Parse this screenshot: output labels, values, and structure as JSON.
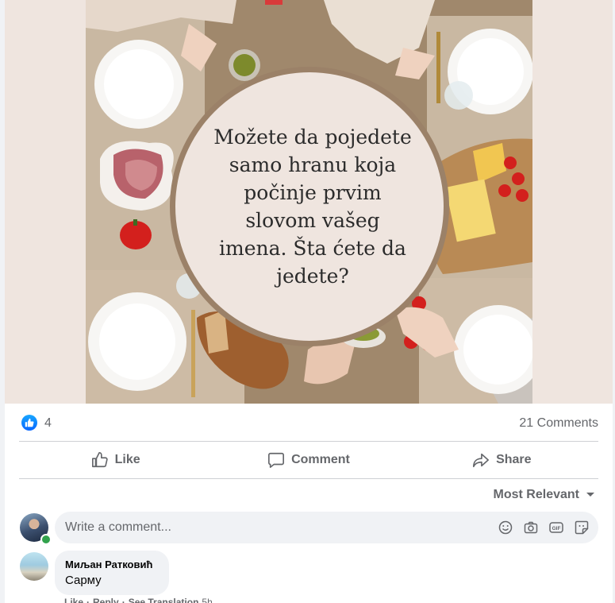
{
  "post": {
    "image_text_lines": [
      "Možete da pojedete",
      "samo hranu koja",
      "počinje prvim",
      "slovom vašeg",
      "imena. Šta ćete da",
      "jedete?"
    ]
  },
  "stats": {
    "reaction_icon": "like-thumb-icon",
    "like_count": "4",
    "comments_count": "21 Comments"
  },
  "actions": {
    "like": "Like",
    "comment": "Comment",
    "share": "Share"
  },
  "sort": {
    "label": "Most Relevant"
  },
  "composer": {
    "placeholder": "Write a comment...",
    "icons": [
      "emoji-icon",
      "camera-icon",
      "gif-icon",
      "sticker-icon"
    ]
  },
  "comments": [
    {
      "author": "Миљан Ратковић",
      "text": "Сарму",
      "actions": [
        "Like",
        "Reply",
        "See Translation"
      ],
      "time": "5h"
    }
  ],
  "colors": {
    "accent": "#0866ff",
    "muted_text": "#65676b",
    "bubble_bg": "#f0f2f5",
    "online": "#31a24c"
  }
}
